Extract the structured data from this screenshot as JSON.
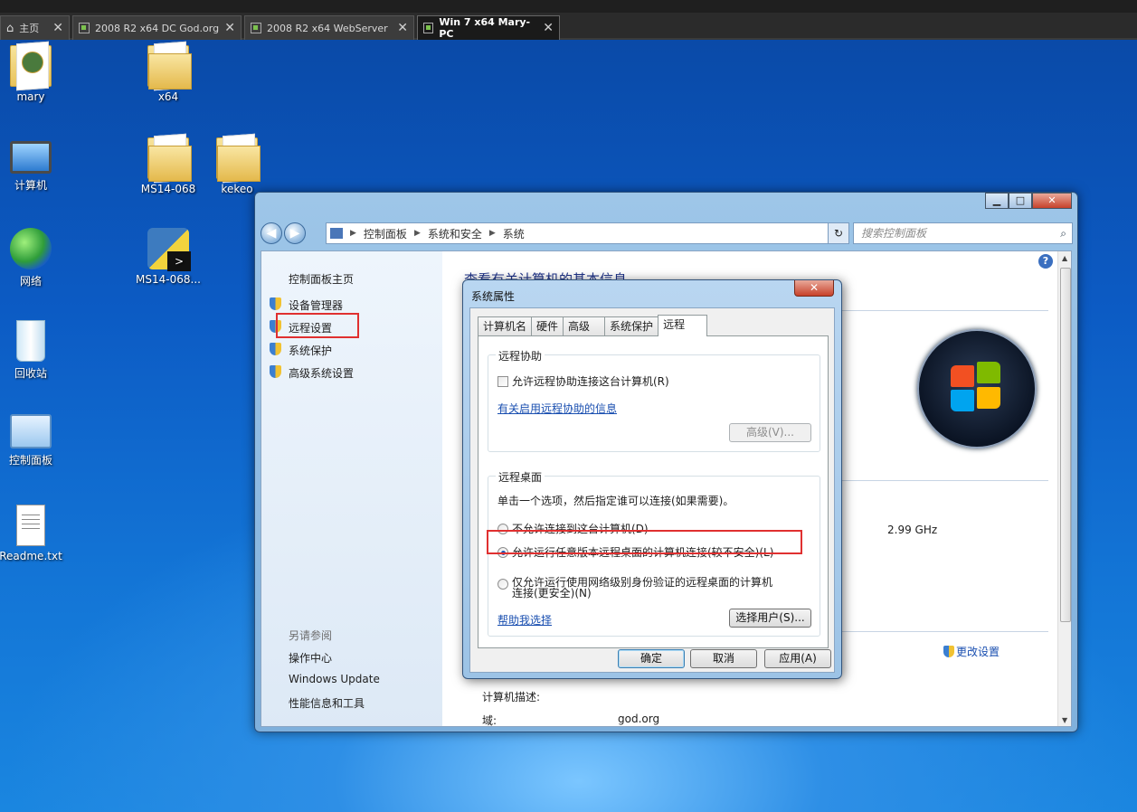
{
  "vm_tabs": [
    {
      "label": "主页",
      "icon": "home-icon"
    },
    {
      "label": "2008 R2 x64 DC God.org",
      "icon": "vm-icon"
    },
    {
      "label": "2008 R2 x64 WebServer",
      "icon": "vm-icon"
    },
    {
      "label": "Win 7 x64 Mary-PC",
      "icon": "vm-icon",
      "active": true
    }
  ],
  "desktop_icons": [
    {
      "label": "mary",
      "icon": "user-folder-icon"
    },
    {
      "label": "x64",
      "icon": "folder-icon"
    },
    {
      "label": "计算机",
      "icon": "computer-icon"
    },
    {
      "label": "MS14-068",
      "icon": "folder-icon"
    },
    {
      "label": "kekeo",
      "icon": "folder-icon"
    },
    {
      "label": "网络",
      "icon": "network-icon"
    },
    {
      "label": "MS14-068...",
      "icon": "python-exe-icon"
    },
    {
      "label": "回收站",
      "icon": "recycle-bin-icon"
    },
    {
      "label": "控制面板",
      "icon": "control-panel-icon"
    },
    {
      "label": "Readme.txt",
      "icon": "text-file-icon"
    }
  ],
  "cp_window": {
    "controls": {
      "minimize": "▁",
      "maximize": "□",
      "close": "✕"
    },
    "breadcrumb": [
      "控制面板",
      "系统和安全",
      "系统"
    ],
    "search_placeholder": "搜索控制面板",
    "sidebar": {
      "home": "控制面板主页",
      "links": [
        "设备管理器",
        "远程设置",
        "系统保护",
        "高级系统设置"
      ],
      "see_also_caption": "另请参阅",
      "see_also": [
        "操作中心",
        "Windows Update",
        "性能信息和工具"
      ]
    },
    "main": {
      "title": "查看有关计算机的基本信息",
      "cpu_speed": "2.99 GHz",
      "change_settings": "更改设置",
      "computer_description_label": "计算机描述:",
      "domain_label": "域:",
      "domain_value": "god.org"
    }
  },
  "dialog": {
    "title": "系统属性",
    "close": "✕",
    "tabs": [
      "计算机名",
      "硬件",
      "高级",
      "系统保护",
      "远程"
    ],
    "selected_tab": "远程",
    "remote_assistance": {
      "group_label": "远程协助",
      "allow_checkbox": "允许远程协助连接这台计算机(R)",
      "info_link": "有关启用远程协助的信息",
      "advanced_button": "高级(V)..."
    },
    "remote_desktop": {
      "group_label": "远程桌面",
      "instruction": "单击一个选项，然后指定谁可以连接(如果需要)。",
      "options": [
        "不允许连接到这台计算机(D)",
        "允许运行任意版本远程桌面的计算机连接(较不安全)(L)",
        "仅允许运行使用网络级别身份验证的远程桌面的计算机连接(更安全)(N)"
      ],
      "selected_option": 1,
      "help_link": "帮助我选择",
      "select_users_button": "选择用户(S)..."
    },
    "buttons": {
      "ok": "确定",
      "cancel": "取消",
      "apply": "应用(A)"
    }
  }
}
